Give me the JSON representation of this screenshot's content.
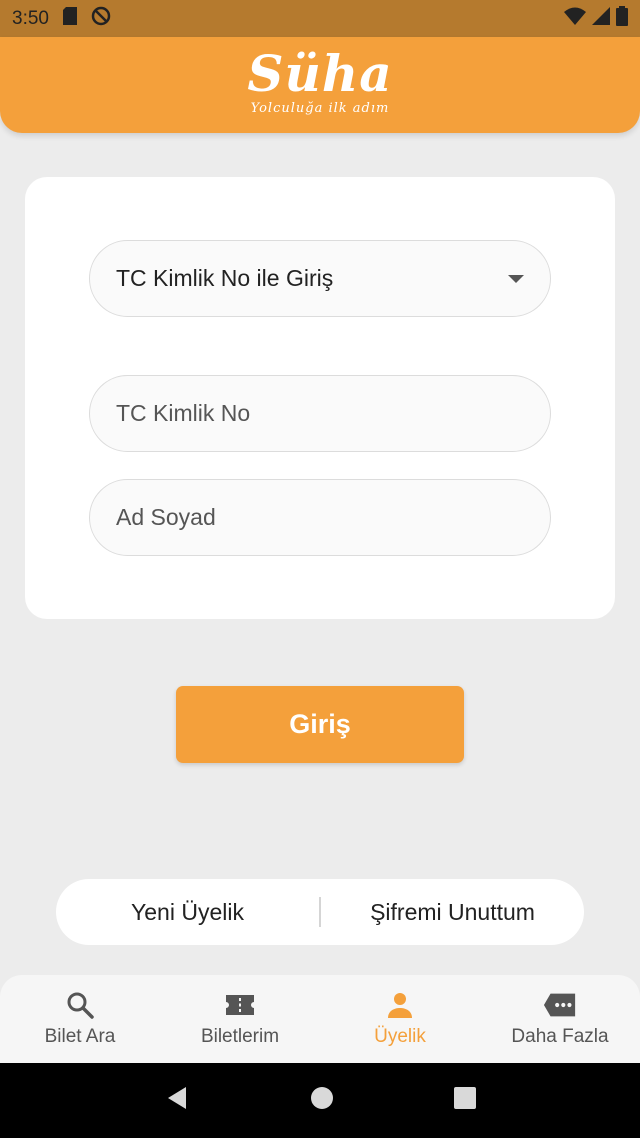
{
  "status": {
    "time": "3:50"
  },
  "header": {
    "logo_title": "Süha",
    "logo_subtitle": "Yolculuğa ilk adım"
  },
  "form": {
    "login_type_selected": "TC Kimlik No ile Giriş",
    "tc_placeholder": "TC Kimlik No",
    "name_placeholder": "Ad Soyad"
  },
  "login_button": "Giriş",
  "links": {
    "register": "Yeni Üyelik",
    "forgot": "Şifremi Unuttum"
  },
  "bottom_nav": [
    {
      "label": "Bilet Ara",
      "icon": "search-icon"
    },
    {
      "label": "Biletlerim",
      "icon": "ticket-icon"
    },
    {
      "label": "Üyelik",
      "icon": "person-icon",
      "active": true
    },
    {
      "label": "Daha Fazla",
      "icon": "more-tag-icon"
    }
  ],
  "colors": {
    "accent": "#f4a03b",
    "status_bar": "#b57a2e",
    "background": "#ececec"
  }
}
